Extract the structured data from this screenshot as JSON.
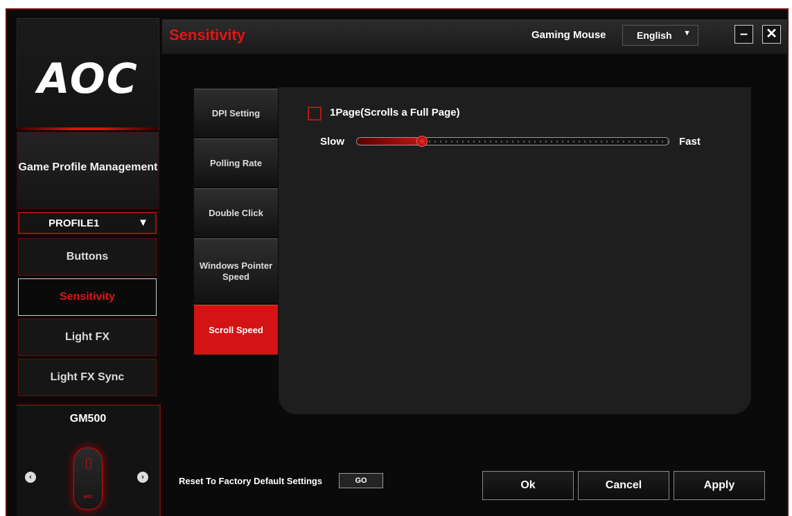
{
  "app": {
    "logo": "AOC",
    "section_title": "Sensitivity",
    "device_type": "Gaming Mouse",
    "language": "English"
  },
  "sidebar": {
    "profile_management": "Game Profile Management",
    "profile_selected": "PROFILE1",
    "items": [
      {
        "label": "Buttons",
        "active": false
      },
      {
        "label": "Sensitivity",
        "active": true
      },
      {
        "label": "Light FX",
        "active": false
      },
      {
        "label": "Light FX Sync",
        "active": false
      }
    ],
    "device_name": "GM500",
    "device_logo": "AOC"
  },
  "subtabs": [
    {
      "label": "DPI Setting",
      "active": false
    },
    {
      "label": "Polling Rate",
      "active": false
    },
    {
      "label": "Double Click",
      "active": false
    },
    {
      "label": "Windows Pointer Speed",
      "active": false
    },
    {
      "label": "Scroll Speed",
      "active": true
    }
  ],
  "scroll": {
    "checkbox_label": "1Page(Scrolls a  Full Page)",
    "checked": false,
    "slow_label": "Slow",
    "fast_label": "Fast",
    "value_fraction": 0.21
  },
  "footer": {
    "reset_label": "Reset To Factory Default Settings",
    "go_label": "GO",
    "ok_label": "Ok",
    "cancel_label": "Cancel",
    "apply_label": "Apply"
  },
  "colors": {
    "accent": "#d41414",
    "background": "#0a0a0a",
    "panel": "#1e1e1e"
  }
}
